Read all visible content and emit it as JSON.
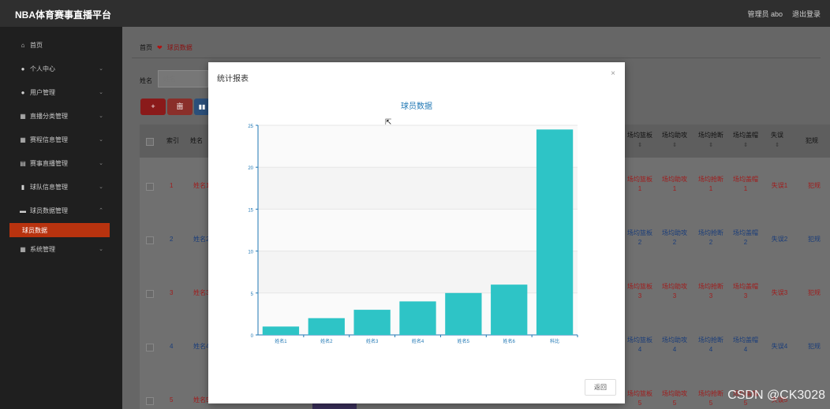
{
  "header": {
    "brand": "NBA体育赛事直播平台",
    "user": "管理员 abo",
    "logout": "退出登录"
  },
  "sidebar": {
    "items": [
      {
        "label": "首页",
        "icon": "home-icon",
        "chevron": false
      },
      {
        "label": "个人中心",
        "icon": "user-icon",
        "chevron": true
      },
      {
        "label": "用户管理",
        "icon": "users-icon",
        "chevron": true
      },
      {
        "label": "直播分类管理",
        "icon": "grid-icon",
        "chevron": true
      },
      {
        "label": "赛程信息管理",
        "icon": "grid-icon",
        "chevron": true
      },
      {
        "label": "赛事直播管理",
        "icon": "doc-icon",
        "chevron": true
      },
      {
        "label": "球队信息管理",
        "icon": "bar-icon",
        "chevron": true
      },
      {
        "label": "球员数据管理",
        "icon": "box-icon",
        "chevron": true
      }
    ],
    "active_sub": "球员数据",
    "bottom_item": {
      "label": "系统管理",
      "icon": "grid-icon"
    }
  },
  "breadcrumb": {
    "home": "首页",
    "current": "球员数据"
  },
  "search": {
    "label": "姓名",
    "placeholder": "姓名"
  },
  "toolbar": {
    "add": "+",
    "delete": "亩",
    "stats": "📊"
  },
  "table": {
    "headers": {
      "index": "索引",
      "name": "姓名",
      "rebound": "场均篮板",
      "assist": "场均助攻",
      "steal": "场均抢断",
      "block": "场均盖帽",
      "turnover": "失误",
      "foul": "犯规"
    },
    "rows": [
      {
        "index": "1",
        "name": "姓名1",
        "rebound": "场均篮板 1",
        "assist": "场均助攻 1",
        "steal": "场均抢断 1",
        "block": "场均盖帽 1",
        "turnover": "失误1",
        "foul": "犯规"
      },
      {
        "index": "2",
        "name": "姓名2",
        "rebound": "场均篮板 2",
        "assist": "场均助攻 2",
        "steal": "场均抢断 2",
        "block": "场均盖帽 2",
        "turnover": "失误2",
        "foul": "犯规"
      },
      {
        "index": "3",
        "name": "姓名3",
        "rebound": "场均篮板 3",
        "assist": "场均助攻 3",
        "steal": "场均抢断 3",
        "block": "场均盖帽 3",
        "turnover": "失误3",
        "foul": "犯规"
      },
      {
        "index": "4",
        "name": "姓名4",
        "rebound": "场均篮板 4",
        "assist": "场均助攻 4",
        "steal": "场均抢断 4",
        "block": "场均盖帽 4",
        "turnover": "失误4",
        "foul": "犯规"
      },
      {
        "index": "5",
        "name": "姓名5",
        "rebound": "场均篮板 5",
        "assist": "场均助攻 5",
        "steal": "场均抢断 5",
        "block": "场均盖帽 5",
        "turnover": "失误5",
        "foul": "犯规"
      }
    ]
  },
  "modal": {
    "title": "统计报表",
    "close": "×",
    "return_label": "返回"
  },
  "chart_data": {
    "type": "bar",
    "title": "球员数据",
    "categories": [
      "姓名1",
      "姓名2",
      "姓名3",
      "姓名4",
      "姓名5",
      "姓名6",
      "科比"
    ],
    "values": [
      1,
      2,
      3,
      4,
      5,
      6,
      24.5
    ],
    "ylim": [
      0,
      25
    ],
    "yticks": [
      0,
      5,
      10,
      15,
      20,
      25
    ],
    "bar_color": "#2ec4c6",
    "grid": true
  },
  "watermark": "CSDN @CK3028",
  "colors": {
    "accent": "#b8330f",
    "topbar": "#2f2f2f",
    "sidebar": "#1f1f1f"
  }
}
